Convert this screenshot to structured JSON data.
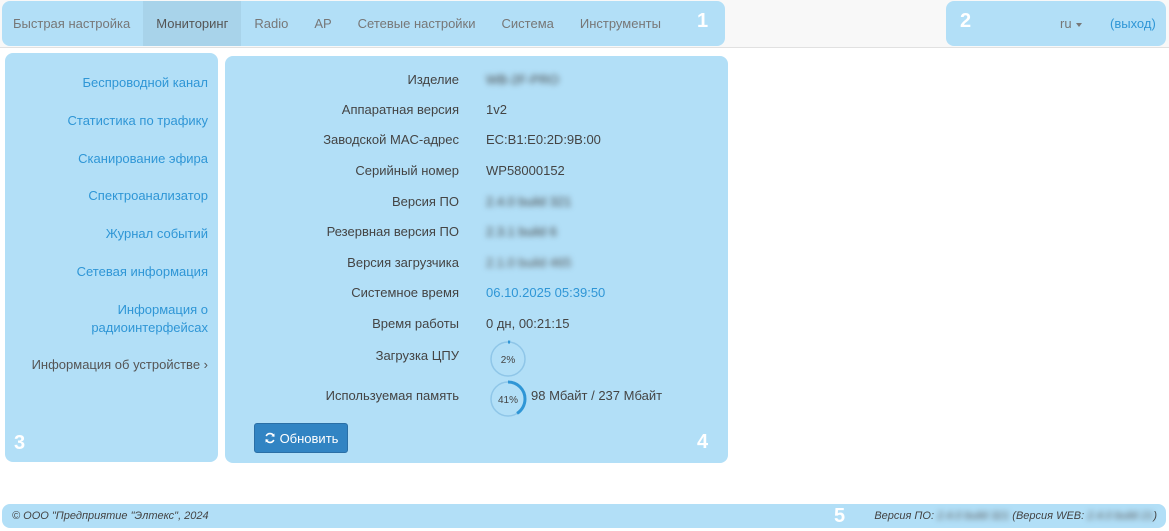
{
  "nav": {
    "items": [
      "Быстрая настройка",
      "Мониторинг",
      "Radio",
      "AP",
      "Сетевые настройки",
      "Система",
      "Инструменты"
    ]
  },
  "header": {
    "lang": "ru",
    "logout": "(выход)"
  },
  "markers": [
    "1",
    "2",
    "3",
    "4",
    "5"
  ],
  "sidebar": {
    "items": [
      "Беспроводной канал",
      "Статистика по трафику",
      "Сканирование эфира",
      "Спектроанализатор",
      "Журнал событий",
      "Сетевая информация",
      "Информация о радиоинтерфейсах",
      "Информация об устройстве ›"
    ]
  },
  "info": {
    "rows": [
      {
        "label": "Изделие",
        "value": "WB-2F-PRO"
      },
      {
        "label": "Аппаратная версия",
        "value": "1v2"
      },
      {
        "label": "Заводской MAC-адрес",
        "value": "EC:B1:E0:2D:9B:00"
      },
      {
        "label": "Серийный номер",
        "value": "WP58000152"
      },
      {
        "label": "Версия ПО",
        "value": "2.4.0 build 321"
      },
      {
        "label": "Резервная версия ПО",
        "value": "2.3.1 build 6"
      },
      {
        "label": "Версия загрузчика",
        "value": "2.1.0 build 465"
      },
      {
        "label": "Системное время",
        "value": "06.10.2025 05:39:50"
      },
      {
        "label": "Время работы",
        "value": "0 дн, 00:21:15"
      },
      {
        "label": "Загрузка ЦПУ",
        "value": ""
      },
      {
        "label": "Используемая память",
        "value": "98 Мбайт / 237 Мбайт"
      }
    ],
    "cpu": {
      "percent": 2,
      "text": "2%"
    },
    "mem": {
      "percent": 41,
      "text": "41%"
    },
    "refresh": "Обновить"
  },
  "footer": {
    "copyright": "© ООО \"Предприятие \"Элтекс\", 2024",
    "version_prefix": "Версия ПО: ",
    "version": "2.4.0 build 321",
    "web_prefix": " (Версия WEB: ",
    "web": "2.4.0 build 21",
    "web_suffix": ")"
  },
  "colors": {
    "highlight": "#b2dff7",
    "link": "#2f96d6",
    "button": "#3184c3",
    "gauge": "#2f96d6"
  }
}
